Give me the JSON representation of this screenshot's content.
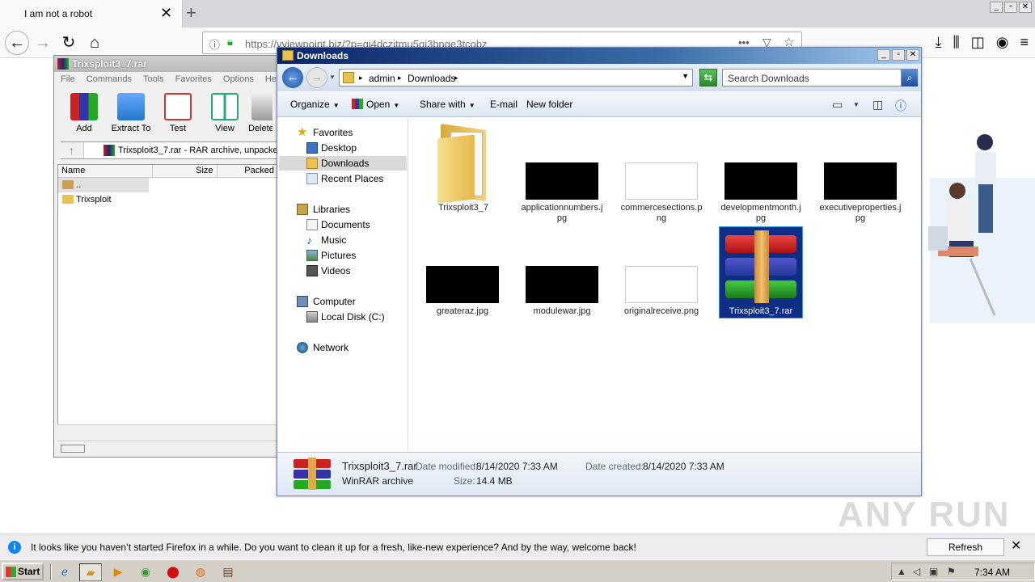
{
  "browser": {
    "tab_title": "I am not a robot",
    "tab_close": "✕",
    "new_tab": "+",
    "url_display": "https://vyiewpoint.biz/?p=gi4dczjtmu5gi3bnge3tcobz",
    "window_controls": [
      "_",
      "▫",
      "✕"
    ],
    "url_more": "•••"
  },
  "winrar": {
    "title": "Trixsploit3_7.rar",
    "menu": [
      "File",
      "Commands",
      "Tools",
      "Favorites",
      "Options",
      "Help"
    ],
    "toolbar": [
      "Add",
      "Extract To",
      "Test",
      "View",
      "Delete"
    ],
    "address_text": "Trixsploit3_7.rar - RAR archive, unpacke",
    "columns": [
      "Name",
      "Size",
      "Packed"
    ],
    "rows": [
      "..",
      "Trixsploit"
    ]
  },
  "explorer": {
    "title": "Downloads",
    "breadcrumbs": [
      "admin",
      "Downloads"
    ],
    "search_placeholder": "Search Downloads",
    "commands": {
      "organize": "Organize",
      "open": "Open",
      "share_with": "Share with",
      "email": "E-mail",
      "new_folder": "New folder"
    },
    "nav": {
      "favorites": "Favorites",
      "desktop": "Desktop",
      "downloads": "Downloads",
      "recent_places": "Recent Places",
      "libraries": "Libraries",
      "documents": "Documents",
      "music": "Music",
      "pictures": "Pictures",
      "videos": "Videos",
      "computer": "Computer",
      "local_disk": "Local Disk (C:)",
      "network": "Network"
    },
    "files": [
      {
        "name": "Trixsploit3_7"
      },
      {
        "name": "applicationnumbers.jpg"
      },
      {
        "name": "commercesections.png"
      },
      {
        "name": "developmentmonth.jpg"
      },
      {
        "name": "executiveproperties.jpg"
      },
      {
        "name": "greateraz.jpg"
      },
      {
        "name": "modulewar.jpg"
      },
      {
        "name": "originalreceive.png"
      },
      {
        "name": "Trixsploit3_7.rar"
      }
    ],
    "details": {
      "name": "Trixsploit3_7.rar",
      "type": "WinRAR archive",
      "date_modified_label": "Date modified:",
      "date_modified": "8/14/2020 7:33 AM",
      "date_created_label": "Date created:",
      "date_created": "8/14/2020 7:33 AM",
      "size_label": "Size:",
      "size": "14.4 MB"
    }
  },
  "notification": {
    "icon": "i",
    "text": "It looks like you haven’t started Firefox in a while. Do you want to clean it up for a fresh, like-new experience? And by the way, welcome back!",
    "button": "Refresh Firefox…",
    "close": "✕"
  },
  "taskbar": {
    "start": "Start",
    "clock": "7:34 AM"
  },
  "watermark": "ANY RUN"
}
